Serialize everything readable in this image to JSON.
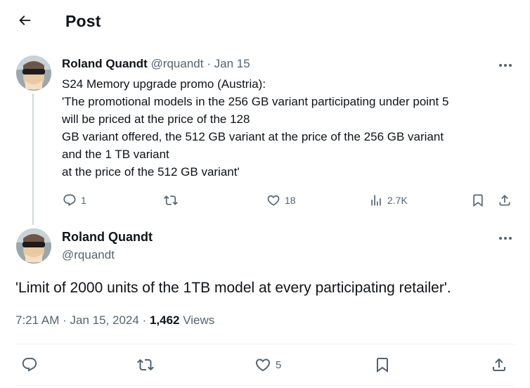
{
  "header": {
    "title": "Post",
    "back_icon": "arrow-left-icon"
  },
  "reply_tweet": {
    "author_name": "Roland Quandt",
    "handle": "@rquandt",
    "separator": "·",
    "date": "Jan 15",
    "lines": [
      "S24 Memory upgrade promo (Austria):",
      "'The promotional models in the 256 GB variant participating under point 5",
      "will be priced at the price of the 128",
      "GB variant offered, the 512 GB variant at the price of the 256 GB variant",
      "and the 1 TB variant",
      "at the price of the 512 GB variant'"
    ],
    "actions": {
      "reply_count": "1",
      "retweet_count": "",
      "like_count": "18",
      "views_count": "2.7K"
    }
  },
  "main_tweet": {
    "author_name": "Roland Quandt",
    "handle": "@rquandt",
    "text": "'Limit of 2000 units of the 1TB model at every participating retailer'.",
    "time": "7:21 AM",
    "date": "Jan 15, 2024",
    "separator": "·",
    "views_count": "1,462",
    "views_label": "Views",
    "actions": {
      "like_count": "5"
    }
  },
  "colors": {
    "text": "#0f1419",
    "muted": "#536471",
    "divider": "#eff3f4",
    "thread_line": "#cfd9de"
  }
}
